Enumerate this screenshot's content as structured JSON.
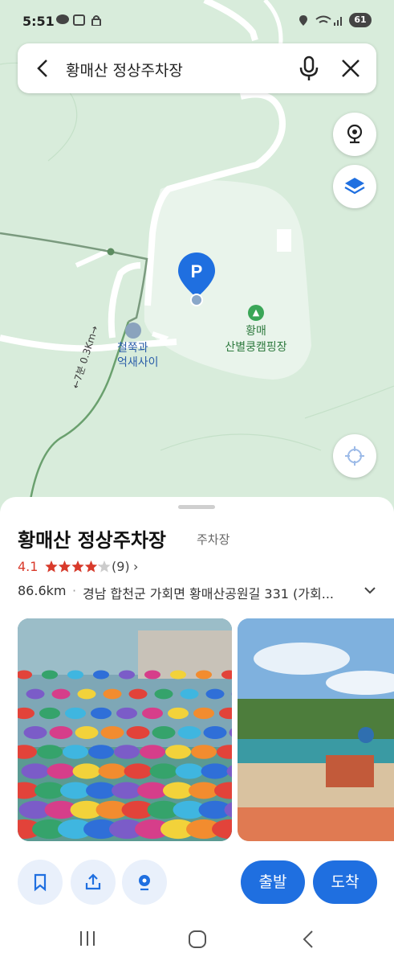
{
  "status_bar": {
    "time": "5:51",
    "battery": "61"
  },
  "search": {
    "title": "황매산 정상주차장"
  },
  "map": {
    "pin_label": "P",
    "restaurant_label_1": "철쭉과",
    "restaurant_label_2": "억새사이",
    "camping_label_1": "황매",
    "camping_label_2": "산별쿵캠핑장",
    "route_label": "←7분 0.3Km→",
    "colors": {
      "map_bg": "#d8ecdb",
      "area": "#e8f3ea",
      "road": "#ffffff",
      "pin": "#1f6fe0",
      "camp": "#3aa657"
    }
  },
  "place": {
    "name": "황매산 정상주차장",
    "category": "주차장",
    "rating": "4.1",
    "rating_value": 4.1,
    "review_count": "(9)",
    "review_chevron": "›",
    "distance": "86.6km",
    "separator": "·",
    "address": "경남 합천군 가회면 황매산공원길 331 (가회..."
  },
  "actions": {
    "depart_label": "출발",
    "arrive_label": "도착",
    "accent_color": "#1f6fe0"
  }
}
